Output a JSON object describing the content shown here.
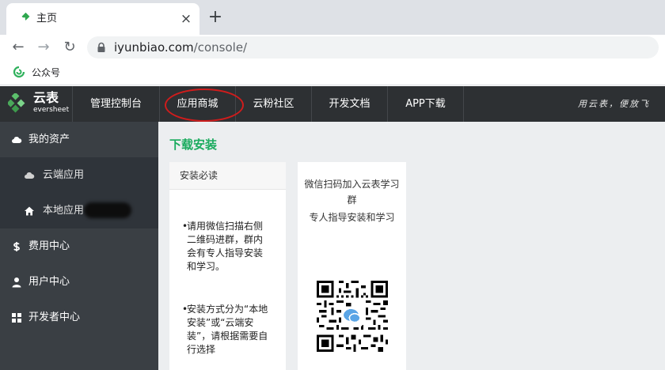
{
  "browser": {
    "tab_title": "主页",
    "tab_close": "×",
    "new_tab": "+",
    "back": "←",
    "forward": "→",
    "reload": "↻",
    "url_host": "iyunbiao.com",
    "url_path": "/console/",
    "bookmark_label": "公众号"
  },
  "app": {
    "logo_cn": "云表",
    "logo_en": "eversheet",
    "nav": [
      "管理控制台",
      "应用商城",
      "云粉社区",
      "开发文档",
      "APP下载"
    ],
    "slogan": "用云表，便放飞",
    "sidebar": {
      "my_assets": "我的资产",
      "cloud_apps": "云端应用",
      "local_apps": "本地应用",
      "billing": "费用中心",
      "user_center": "用户中心",
      "developer_center": "开发者中心"
    },
    "section_title": "下载安装",
    "card1": {
      "header": "安装必读",
      "tip1": "请用微信扫描右侧二维码进群，群内会有专人指导安装和学习。",
      "tip2": "安装方式分为“本地安装”或“云端安装”，请根据需要自行选择"
    },
    "card2": {
      "line1": "微信扫码加入云表学习",
      "line2": "群",
      "line3": "专人指导安装和学习"
    }
  },
  "colors": {
    "accent_green": "#1aab5e",
    "nav_bg": "#2d3033",
    "sidebar_bg": "#3a3f44",
    "highlight_ring": "#d01c1c"
  }
}
